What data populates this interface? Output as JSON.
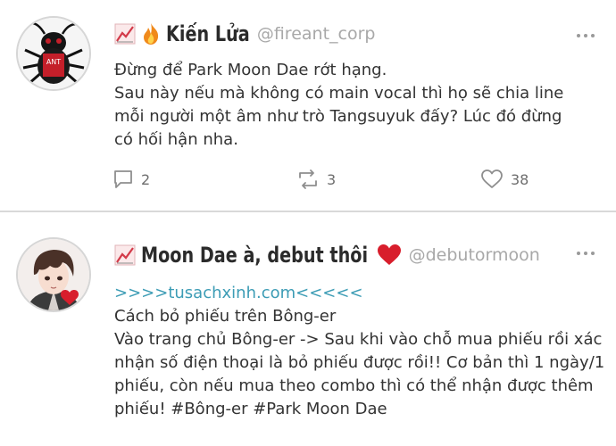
{
  "posts": [
    {
      "display_name": "Kiến Lửa",
      "handle": "@fireant_corp",
      "body_lines": [
        "Đừng để Park Moon Dae rớt hạng.",
        "Sau này nếu mà không có main vocal thì họ sẽ chia line",
        "mỗi người một âm như trò Tangsuyuk đấy? Lúc đó đừng",
        "có hối hận nha."
      ],
      "reply_count": "2",
      "retweet_count": "3",
      "like_count": "38"
    },
    {
      "display_name": "Moon Dae à, debut thôi",
      "handle": "@debutormoon",
      "link_text": ">>>>tusachxinh.com<<<<<",
      "body_lines": [
        "Cách bỏ phiếu trên Bông-er",
        "Vào trang chủ Bông-er -> Sau khi vào chỗ mua phiếu rồi xác",
        "nhận số điện thoại là bỏ phiếu được rồi!! Cơ bản thì 1 ngày/1",
        "phiếu, còn nếu mua theo combo thì có thể nhận được thêm",
        "phiếu! #Bông-er #Park Moon Dae"
      ]
    }
  ],
  "icons": {
    "trend": "trend-chart-icon",
    "fire": "fire-icon",
    "heart": "red-heart-icon",
    "more": "more-dots-icon",
    "reply": "reply-icon",
    "retweet": "retweet-icon",
    "like": "like-icon"
  },
  "colors": {
    "link": "#3c9cb5",
    "handle": "#a8a8a8",
    "heart": "#d81e2c",
    "divider": "#d9d9d9"
  }
}
